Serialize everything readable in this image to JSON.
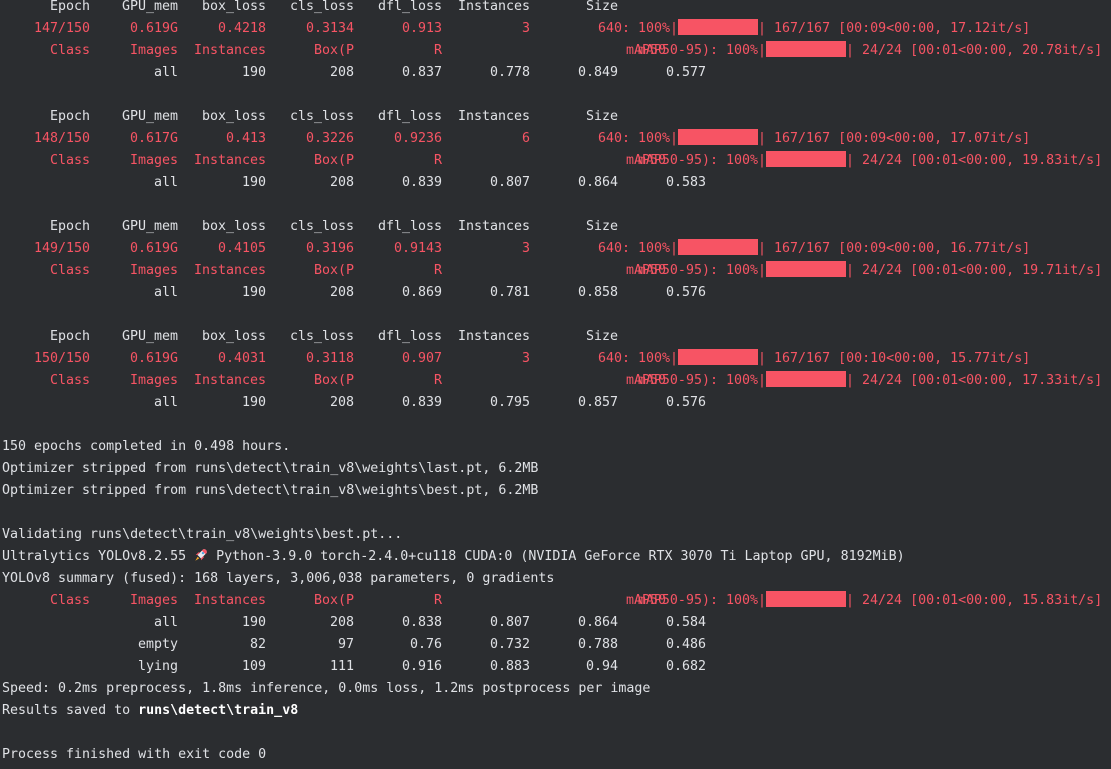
{
  "palette": {
    "background": "#2b2d30",
    "text": "#dfe1e5",
    "red": "#f75464"
  },
  "header_labels": [
    "Epoch",
    "GPU_mem",
    "box_loss",
    "cls_loss",
    "dfl_loss",
    "Instances",
    "Size"
  ],
  "val_labels": [
    "Class",
    "Images",
    "Instances",
    "Box(P",
    "R",
    "mAP50",
    "mAP50-95): 100%"
  ],
  "epochs": [
    {
      "train": [
        "147/150",
        "0.619G",
        "0.4218",
        "0.3134",
        "0.913",
        "3",
        "640: 100%"
      ],
      "train_progress": "167/167 [00:09<00:00, 17.12it/s]",
      "val_progress": "24/24 [00:01<00:00, 20.78it/s]",
      "all": [
        "all",
        "190",
        "208",
        "0.837",
        "0.778",
        "0.849",
        "0.577"
      ]
    },
    {
      "train": [
        "148/150",
        "0.617G",
        "0.413",
        "0.3226",
        "0.9236",
        "6",
        "640: 100%"
      ],
      "train_progress": "167/167 [00:09<00:00, 17.07it/s]",
      "val_progress": "24/24 [00:01<00:00, 19.83it/s]",
      "all": [
        "all",
        "190",
        "208",
        "0.839",
        "0.807",
        "0.864",
        "0.583"
      ]
    },
    {
      "train": [
        "149/150",
        "0.619G",
        "0.4105",
        "0.3196",
        "0.9143",
        "3",
        "640: 100%"
      ],
      "train_progress": "167/167 [00:09<00:00, 16.77it/s]",
      "val_progress": "24/24 [00:01<00:00, 19.71it/s]",
      "all": [
        "all",
        "190",
        "208",
        "0.869",
        "0.781",
        "0.858",
        "0.576"
      ]
    },
    {
      "train": [
        "150/150",
        "0.619G",
        "0.4031",
        "0.3118",
        "0.907",
        "3",
        "640: 100%"
      ],
      "train_progress": "167/167 [00:10<00:00, 15.77it/s]",
      "val_progress": "24/24 [00:01<00:00, 17.33it/s]",
      "all": [
        "all",
        "190",
        "208",
        "0.839",
        "0.795",
        "0.857",
        "0.576"
      ]
    }
  ],
  "summary": {
    "completed": "150 epochs completed in 0.498 hours.",
    "stripped_last": "Optimizer stripped from runs\\detect\\train_v8\\weights\\last.pt, 6.2MB",
    "stripped_best": "Optimizer stripped from runs\\detect\\train_v8\\weights\\best.pt, 6.2MB",
    "validating": "Validating runs\\detect\\train_v8\\weights\\best.pt...",
    "ultralytics_prefix": "Ultralytics YOLOv8.2.55",
    "ultralytics_suffix": "Python-3.9.0 torch-2.4.0+cu118 CUDA:0 (NVIDIA GeForce RTX 3070 Ti Laptop GPU, 8192MiB)",
    "model_summary": "YOLOv8 summary (fused): 168 layers, 3,006,038 parameters, 0 gradients",
    "final_val_progress": "24/24 [00:01<00:00, 15.83it/s]",
    "final_rows": [
      [
        "all",
        "190",
        "208",
        "0.838",
        "0.807",
        "0.864",
        "0.584"
      ],
      [
        "empty",
        "82",
        "97",
        "0.76",
        "0.732",
        "0.788",
        "0.486"
      ],
      [
        "lying",
        "109",
        "111",
        "0.916",
        "0.883",
        "0.94",
        "0.682"
      ]
    ],
    "speed": "Speed: 0.2ms preprocess, 1.8ms inference, 0.0ms loss, 1.2ms postprocess per image",
    "results_prefix": "Results saved to ",
    "results_path": "runs\\detect\\train_v8",
    "exit": "Process finished with exit code 0"
  },
  "icons": {
    "rocket": "rocket-icon",
    "progress_bar": "progress-bar-fill"
  },
  "progress": {
    "train_fraction": 1.0,
    "val_fraction": 1.0
  }
}
